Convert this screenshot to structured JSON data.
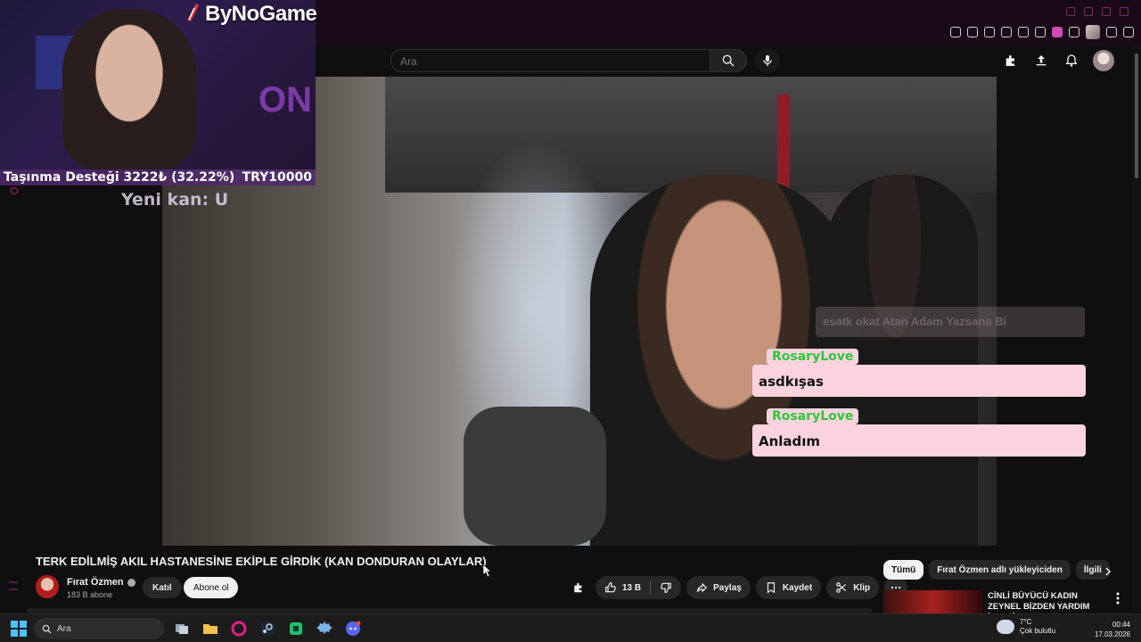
{
  "overlay": {
    "brand": "ByNoGame",
    "donation_goal_label": "Taşınma Desteği 3222₺ (32.22%)",
    "donation_goal_target": "TRY10000",
    "donation_progress_percent": 32.22,
    "new_blood_label": "Yeni kan: U"
  },
  "header": {
    "search_placeholder": "Ara"
  },
  "chat": {
    "faded_message": "esatk okat Atan Adam Yazsana Bi",
    "messages": [
      {
        "user": "RosaryLove",
        "text": "asdkışas"
      },
      {
        "user": "RosaryLove",
        "text": "Anladım"
      }
    ]
  },
  "video": {
    "title": "TERK EDİLMİŞ AKIL HASTANESİNE EKİPLE GİRDİK (KAN DONDURAN OLAYLAR)",
    "channel_name": "Fırat Özmen",
    "subscribers": "183 B abone",
    "join_label": "Katıl",
    "subscribe_label": "Abone ol",
    "like_count": "13 B",
    "share_label": "Paylaş",
    "save_label": "Kaydet",
    "clip_label": "Klip"
  },
  "sidebar_right": {
    "chips": [
      "Tümü",
      "Fırat Özmen adlı yükleyiciden",
      "İlgili"
    ],
    "recommendation_title": "CİNLİ BÜYÜCÜ KADIN ZEYNEL BİZDEN YARDIM İSTEDİ! – Oğl..."
  },
  "taskbar": {
    "search_label": "Ara",
    "temperature": "7°C",
    "weather": "Çok bulutlu",
    "time": "00:44",
    "date": "17.03.2026"
  },
  "colors": {
    "accent_pink": "#fbd3de",
    "chat_username": "#2fc63c",
    "donation_bar": "#502870",
    "background": "#0f0f0f"
  }
}
